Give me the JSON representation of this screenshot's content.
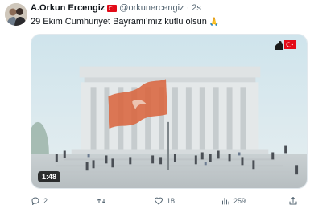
{
  "author": {
    "display_name": "A.Orkun Ercengiz",
    "badge": "turkish-flag-icon",
    "handle": "@orkunercengiz",
    "separator": "·",
    "timestamp": "2s"
  },
  "tweet": {
    "text": "29 Ekim Cumhuriyet Bayramı’mız kutlu olsun",
    "emoji": "🙏"
  },
  "media": {
    "type": "video",
    "duration": "1:48",
    "overlay_icon": "turkish-flag-ataturk-silhouette-icon"
  },
  "actions": {
    "replies": "2",
    "retweets": "",
    "likes": "18",
    "views": "259"
  },
  "colors": {
    "text_primary": "#0f1419",
    "text_secondary": "#536471",
    "flag_red": "#e30a17"
  }
}
